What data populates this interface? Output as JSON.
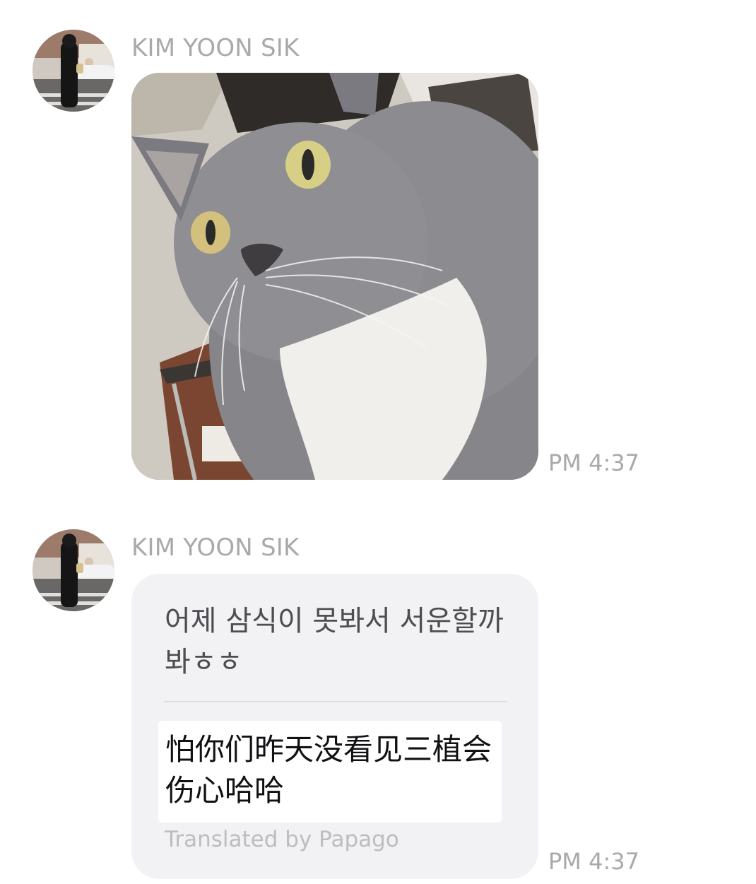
{
  "messages": [
    {
      "sender": "KIM YOON SIK",
      "type": "image",
      "image_alt": "gray cat photo",
      "time": "PM 4:37"
    },
    {
      "sender": "KIM YOON SIK",
      "type": "text",
      "text": "어제 삼식이 못봐서 서운할까봐ㅎㅎ",
      "translation": "怕你们昨天没看见三植会伤心哈哈",
      "translated_by": "Translated by Papago",
      "time": "PM 4:37"
    }
  ],
  "colors": {
    "name": "#a9a9ad",
    "bubble": "#f2f2f4",
    "text": "#4d4d52",
    "translation": "#111114",
    "muted": "#bdbdc1"
  },
  "icons": {
    "avatar": "profile-photo",
    "photo": "cat-photo"
  }
}
